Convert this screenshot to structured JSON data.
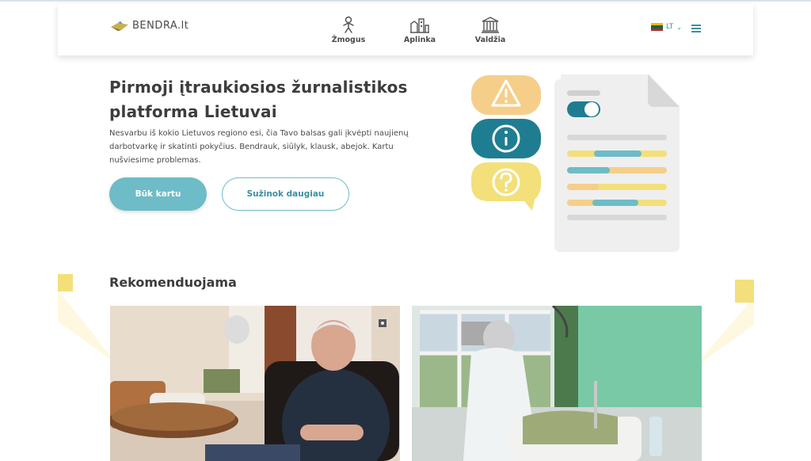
{
  "brand": {
    "logo_text": "BENDRA.lt"
  },
  "nav": {
    "items": [
      {
        "label": "Žmogus",
        "icon": "person-icon"
      },
      {
        "label": "Aplinka",
        "icon": "environment-icon"
      },
      {
        "label": "Valdžia",
        "icon": "government-building-icon"
      }
    ]
  },
  "language": {
    "code": "LT",
    "flag": "lithuania-flag",
    "colors": [
      "#fdb913",
      "#006a44",
      "#c1272d"
    ]
  },
  "hero": {
    "title": "Pirmoji įtraukiosios žurnalistikos platforma Lietuvai",
    "text": "Nesvarbu iš kokio Lietuvos regiono esi, čia Tavo balsas gali įkvėpti naujienų darbotvarkę ir skatinti pokyčius. Bendrauk, siūlyk, klausk, abejok. Kartu nušviesime problemas.",
    "primary_button": "Būk kartu",
    "secondary_button": "Sužinok daugiau"
  },
  "recommended": {
    "title": "Rekomenduojama",
    "cards": [
      {
        "image": "elderly-man-sitting-in-armchair-photo",
        "badge_icon": "lock-icon"
      },
      {
        "image": "hospital-ward-nurse-patient-photo"
      }
    ]
  },
  "colors": {
    "accent_teal": "#6dbcc7",
    "dark_teal": "#1f7d92",
    "light_orange": "#f5cf8a",
    "yellow": "#f3e07a",
    "deco_yellow": "#f3e07a"
  }
}
